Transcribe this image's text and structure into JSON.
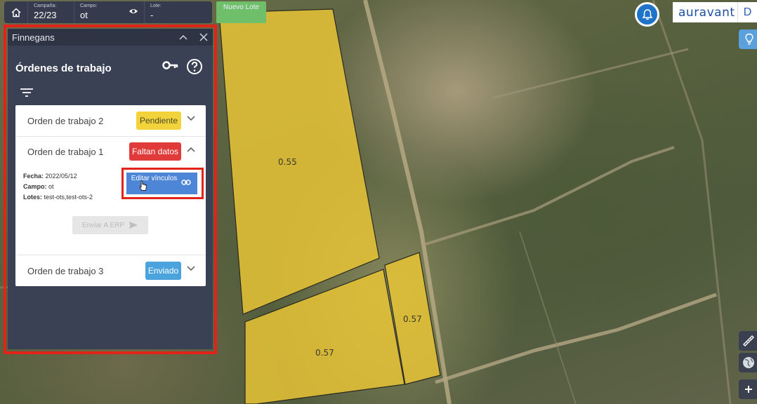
{
  "topbar": {
    "campana_label": "Campaña:",
    "campana_value": "22/23",
    "campo_label": "Campo:",
    "campo_value": "ot",
    "lote_label": "Lote:",
    "lote_value": "-",
    "nuevo_lote_label": "Nuevo Lote"
  },
  "brand": {
    "logo_text": "auravant",
    "user_initial": "D"
  },
  "map": {
    "parcels": [
      "0.55",
      "0.57",
      "0.57"
    ]
  },
  "panel": {
    "header_title": "Finnegans",
    "title": "Órdenes de trabajo",
    "orders": [
      {
        "name": "Orden de trabajo 2",
        "status": "Pendiente"
      },
      {
        "name": "Orden de trabajo 1",
        "status": "Faltan datos"
      },
      {
        "name": "Orden de trabajo 3",
        "status": "Enviado"
      }
    ],
    "details": {
      "fecha_label": "Fecha:",
      "fecha_value": "2022/05/12",
      "campo_label": "Campo:",
      "campo_value": "ot",
      "lotes_label": "Lotes:",
      "lotes_value": "test-ots,test-ots-2"
    },
    "editar_label": "Editar vínculos",
    "enviar_label": "Enviar A ERP"
  },
  "colors": {
    "panel_bg": "#3b4154",
    "highlight": "#e2231a",
    "pendiente": "#f3d33c",
    "faltan": "#e03a3a",
    "enviado": "#4aa3dc",
    "editar": "#4d86d6",
    "nuevo_lote": "#6fbf6a",
    "parcel_fill": "#e7c436"
  },
  "icons": [
    "home-icon",
    "eye-icon",
    "bell-icon",
    "lightbulb-icon",
    "ruler-icon",
    "globe-icon",
    "plus-icon",
    "chevron-up-icon",
    "close-icon",
    "key-icon",
    "help-icon",
    "filter-icon",
    "chevron-down-icon",
    "link-icon",
    "send-icon",
    "cursor-icon"
  ]
}
